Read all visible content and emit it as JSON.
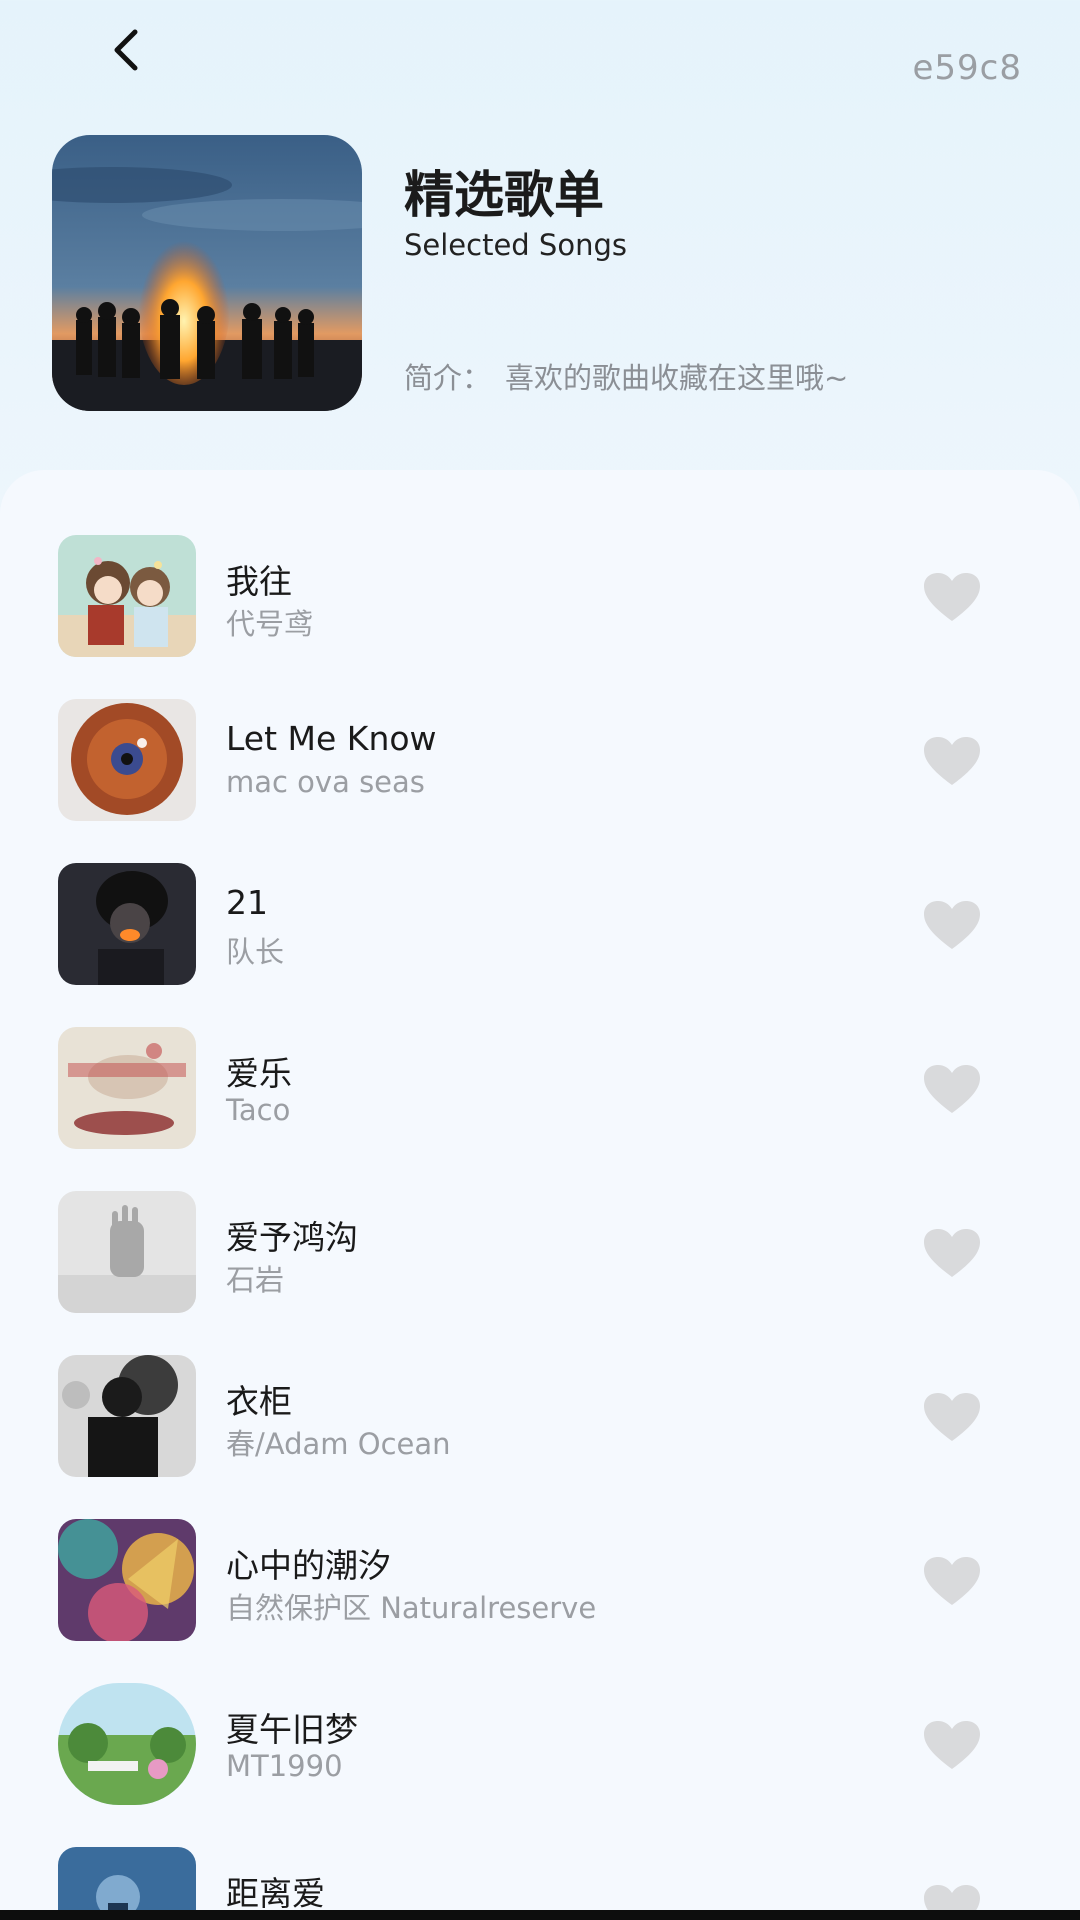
{
  "header": {
    "back_icon": "chevron-left-icon",
    "code": "e59c8",
    "title": "精选歌单",
    "subtitle": "Selected Songs",
    "intro_label": "简介：",
    "intro_text": "喜欢的歌曲收藏在这里哦~"
  },
  "colors": {
    "heart": "#d9dadc",
    "muted_text": "#9b9ea3",
    "background": "#eef6fc"
  },
  "songs": [
    {
      "title": "我往",
      "artist": "代号鸢",
      "favorite": false
    },
    {
      "title": "Let Me Know",
      "artist": "mac ova seas",
      "favorite": false
    },
    {
      "title": "21",
      "artist": "队长",
      "favorite": false
    },
    {
      "title": "爱乐",
      "artist": "Taco",
      "favorite": false
    },
    {
      "title": "爱予鸿沟",
      "artist": "石岩",
      "favorite": false
    },
    {
      "title": "衣柜",
      "artist": "春/Adam Ocean",
      "favorite": false
    },
    {
      "title": "心中的潮汐",
      "artist": "自然保护区 Naturalreserve",
      "favorite": false
    },
    {
      "title": "夏午旧梦",
      "artist": "MT1990",
      "favorite": false
    },
    {
      "title": "距离爱",
      "artist": "",
      "favorite": false
    }
  ]
}
